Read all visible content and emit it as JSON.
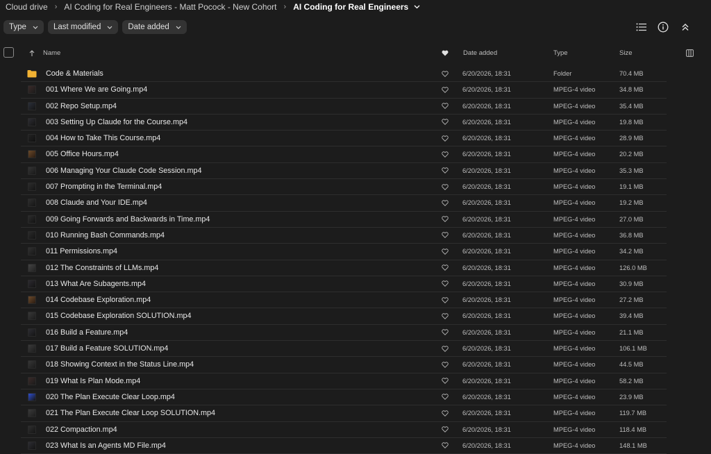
{
  "breadcrumb": {
    "items": [
      "Cloud drive",
      "AI Coding for Real Engineers - Matt Pocock - New Cohort"
    ],
    "current": "AI Coding for Real Engineers"
  },
  "filters": [
    "Type",
    "Last modified",
    "Date added"
  ],
  "columns": {
    "name": "Name",
    "date_added": "Date added",
    "type": "Type",
    "size": "Size"
  },
  "files": [
    {
      "name": "Code & Materials",
      "date": "6/20/2026, 18:31",
      "type": "Folder",
      "size": "70.4 MB",
      "kind": "folder"
    },
    {
      "name": "001 Where We are Going.mp4",
      "date": "6/20/2026, 18:31",
      "type": "MPEG-4 video",
      "size": "34.8 MB",
      "kind": "video"
    },
    {
      "name": "002 Repo Setup.mp4",
      "date": "6/20/2026, 18:31",
      "type": "MPEG-4 video",
      "size": "35.4 MB",
      "kind": "video"
    },
    {
      "name": "003 Setting Up Claude for the Course.mp4",
      "date": "6/20/2026, 18:31",
      "type": "MPEG-4 video",
      "size": "19.8 MB",
      "kind": "video"
    },
    {
      "name": "004 How to Take This Course.mp4",
      "date": "6/20/2026, 18:31",
      "type": "MPEG-4 video",
      "size": "28.9 MB",
      "kind": "video"
    },
    {
      "name": "005 Office Hours.mp4",
      "date": "6/20/2026, 18:31",
      "type": "MPEG-4 video",
      "size": "20.2 MB",
      "kind": "video"
    },
    {
      "name": "006 Managing Your Claude Code Session.mp4",
      "date": "6/20/2026, 18:31",
      "type": "MPEG-4 video",
      "size": "35.3 MB",
      "kind": "video"
    },
    {
      "name": "007 Prompting in the Terminal.mp4",
      "date": "6/20/2026, 18:31",
      "type": "MPEG-4 video",
      "size": "19.1 MB",
      "kind": "video"
    },
    {
      "name": "008 Claude and Your IDE.mp4",
      "date": "6/20/2026, 18:31",
      "type": "MPEG-4 video",
      "size": "19.2 MB",
      "kind": "video"
    },
    {
      "name": "009 Going Forwards and Backwards in Time.mp4",
      "date": "6/20/2026, 18:31",
      "type": "MPEG-4 video",
      "size": "27.0 MB",
      "kind": "video"
    },
    {
      "name": "010 Running Bash Commands.mp4",
      "date": "6/20/2026, 18:31",
      "type": "MPEG-4 video",
      "size": "36.8 MB",
      "kind": "video"
    },
    {
      "name": "011 Permissions.mp4",
      "date": "6/20/2026, 18:31",
      "type": "MPEG-4 video",
      "size": "34.2 MB",
      "kind": "video"
    },
    {
      "name": "012 The Constraints of LLMs.mp4",
      "date": "6/20/2026, 18:31",
      "type": "MPEG-4 video",
      "size": "126.0 MB",
      "kind": "video"
    },
    {
      "name": "013 What Are Subagents.mp4",
      "date": "6/20/2026, 18:31",
      "type": "MPEG-4 video",
      "size": "30.9 MB",
      "kind": "video"
    },
    {
      "name": "014 Codebase Exploration.mp4",
      "date": "6/20/2026, 18:31",
      "type": "MPEG-4 video",
      "size": "27.2 MB",
      "kind": "video"
    },
    {
      "name": "015 Codebase Exploration SOLUTION.mp4",
      "date": "6/20/2026, 18:31",
      "type": "MPEG-4 video",
      "size": "39.4 MB",
      "kind": "video"
    },
    {
      "name": "016 Build a Feature.mp4",
      "date": "6/20/2026, 18:31",
      "type": "MPEG-4 video",
      "size": "21.1 MB",
      "kind": "video"
    },
    {
      "name": "017 Build a Feature SOLUTION.mp4",
      "date": "6/20/2026, 18:31",
      "type": "MPEG-4 video",
      "size": "106.1 MB",
      "kind": "video"
    },
    {
      "name": "018 Showing Context in the Status Line.mp4",
      "date": "6/20/2026, 18:31",
      "type": "MPEG-4 video",
      "size": "44.5 MB",
      "kind": "video"
    },
    {
      "name": "019 What Is Plan Mode.mp4",
      "date": "6/20/2026, 18:31",
      "type": "MPEG-4 video",
      "size": "58.2 MB",
      "kind": "video"
    },
    {
      "name": "020 The Plan Execute Clear Loop.mp4",
      "date": "6/20/2026, 18:31",
      "type": "MPEG-4 video",
      "size": "23.9 MB",
      "kind": "video"
    },
    {
      "name": "021 The Plan Execute Clear Loop SOLUTION.mp4",
      "date": "6/20/2026, 18:31",
      "type": "MPEG-4 video",
      "size": "119.7 MB",
      "kind": "video"
    },
    {
      "name": "022 Compaction.mp4",
      "date": "6/20/2026, 18:31",
      "type": "MPEG-4 video",
      "size": "118.4 MB",
      "kind": "video"
    },
    {
      "name": "023 What Is an Agents MD File.mp4",
      "date": "6/20/2026, 18:31",
      "type": "MPEG-4 video",
      "size": "148.1 MB",
      "kind": "video"
    }
  ],
  "colors": {
    "background": "#1c1c1c",
    "folder": "#f2b233",
    "chip": "#333333"
  }
}
